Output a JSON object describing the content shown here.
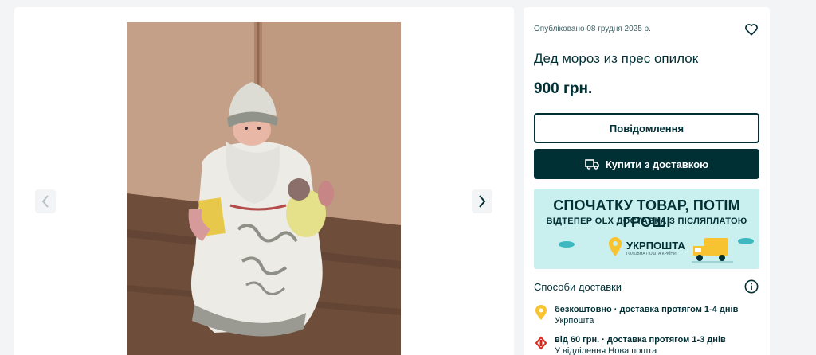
{
  "gallery": {
    "prev_icon": "chevron-left-icon",
    "next_icon": "chevron-right-icon",
    "image_alt": "Дед мороз из прес опилок"
  },
  "ad": {
    "published": "Опубліковано 08 грудня 2025 р.",
    "title": "Дед мороз из прес опилок",
    "price": "900 грн.",
    "favorite_icon": "heart-icon"
  },
  "actions": {
    "message_label": "Повідомлення",
    "buy_label": "Купити з доставкою",
    "buy_icon": "truck-icon"
  },
  "banner": {
    "headline": "СПОЧАТКУ ТОВАР, ПОТІМ ГРОШІ",
    "subheadline": "ВІДТЕПЕР OLX ДОСТАВКА З ПІСЛЯПЛАТОЮ",
    "brand": "УКРПОШТА",
    "brand_tagline": "ГОЛОВНА ПОШТА КРАЇНИ"
  },
  "delivery": {
    "heading": "Способи доставки",
    "options": [
      {
        "main": "безкоштовно · доставка протягом 1-4 днів",
        "sub": "Укрпошта",
        "icon": "ukrposhta-pin-icon"
      },
      {
        "main": "від 60 грн. · доставка протягом 1-3 днів",
        "sub": "У відділення Нова пошта",
        "icon": "nova-poshta-icon"
      }
    ]
  },
  "colors": {
    "primary": "#002f34",
    "page_bg": "#f2f4f5",
    "banner_bg": "#c9efee",
    "ukrposhta_yellow": "#f7c330"
  }
}
